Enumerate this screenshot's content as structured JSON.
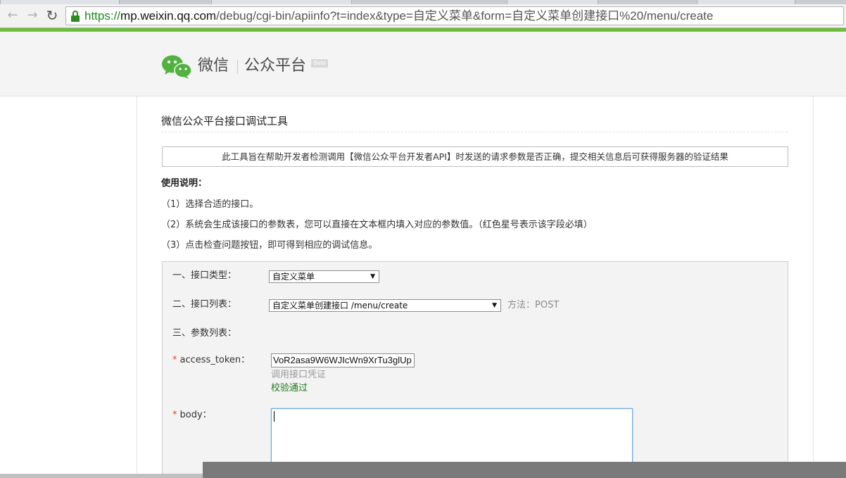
{
  "browser": {
    "back_glyph": "←",
    "forward_glyph": "→",
    "reload_glyph": "↻",
    "url_scheme": "https://",
    "url_host": "mp.weixin.qq.com",
    "url_rest": "/debug/cgi-bin/apiinfo?t=index&type=自定义菜单&form=自定义菜单创建接口%20/menu/create"
  },
  "header": {
    "brand_name": "微信",
    "brand_sub": "公众平台",
    "beta_label": "Beta"
  },
  "page": {
    "title": "微信公众平台接口调试工具",
    "notice": "此工具旨在帮助开发者检测调用【微信公众平台开发者API】时发送的请求参数是否正确，提交相关信息后可获得服务器的验证结果",
    "usage_title": "使用说明：",
    "steps": [
      "（1）选择合适的接口。",
      "（2）系统会生成该接口的参数表，您可以直接在文本框内填入对应的参数值。（红色星号表示该字段必填）",
      "（3）点击检查问题按钮，即可得到相应的调试信息。"
    ]
  },
  "form": {
    "api_type_label": "一、接口类型：",
    "api_type_value": "自定义菜单",
    "api_list_label": "二、接口列表：",
    "api_list_value": "自定义菜单创建接口 /menu/create",
    "method_text": "方法：POST",
    "params_label": "三、参数列表：",
    "required_mark": "*",
    "access_token_label": "access_token：",
    "access_token_value": "VoR2asa9W6WJIcWn9XrTu3glUp",
    "access_token_hint": "调用接口凭证",
    "access_token_status": "校验通过",
    "body_label": "body：",
    "body_value": ""
  },
  "colors": {
    "accent_green": "#6bbf3b",
    "required_red": "#e04a1a",
    "valid_green": "#1f7a1f"
  },
  "icons": {
    "logo": "wechat-logo-icon",
    "lock": "lock-icon",
    "dropdown": "dropdown-arrow-icon"
  }
}
